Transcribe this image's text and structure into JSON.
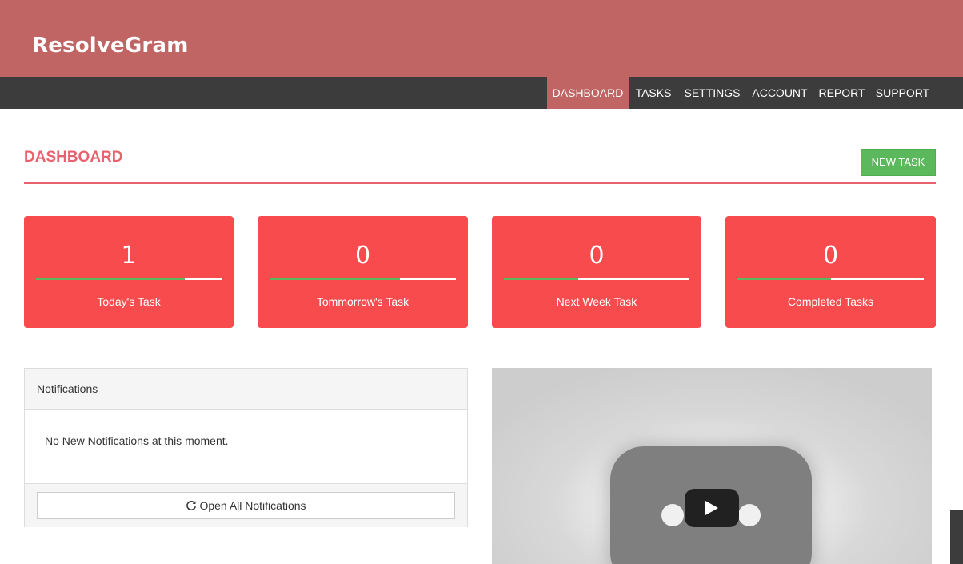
{
  "brand": "ResolveGram",
  "nav": [
    "DASHBOARD",
    "TASKS",
    "SETTINGS",
    "ACCOUNT",
    "REPORT",
    "SUPPORT"
  ],
  "page_title": "DASHBOARD",
  "new_task_label": "NEW TASK",
  "colors": {
    "header": "#c06464",
    "navbar": "#3c3c3c",
    "accent": "#e9616e",
    "card": "#f84b4e",
    "success": "#5cb85c"
  },
  "cards": [
    {
      "count": "1",
      "label": "Today's Task",
      "progress": 0.8
    },
    {
      "count": "0",
      "label": "Tommorrow's Task",
      "progress": 0.7
    },
    {
      "count": "0",
      "label": "Next Week Task",
      "progress": 0.4
    },
    {
      "count": "0",
      "label": "Completed Tasks",
      "progress": 0.5
    }
  ],
  "notifications": {
    "title": "Notifications",
    "message": "No New Notifications at this moment.",
    "open_all": "Open All Notifications",
    "open_all_icon": "refresh-icon"
  },
  "video": {
    "play_icon": "play-icon"
  }
}
